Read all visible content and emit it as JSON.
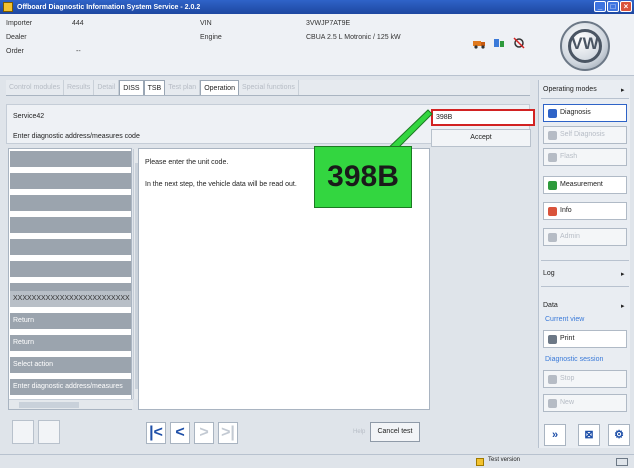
{
  "window": {
    "title": "Offboard Diagnostic Information System Service - 2.0.2"
  },
  "header": {
    "importer_label": "Importer",
    "importer_value": "444",
    "dealer_label": "Dealer",
    "order_label": "Order",
    "order_value": "--",
    "vin_label": "VIN",
    "vin_value": "3VWJP7AT9E",
    "engine_label": "Engine",
    "engine_value": "CBUA 2.5 L Motronic / 125 kW",
    "logo_text": "VW"
  },
  "tabs": [
    {
      "label": "Control modules"
    },
    {
      "label": "Results"
    },
    {
      "label": "Detail"
    },
    {
      "label": "DISS"
    },
    {
      "label": "TSB"
    },
    {
      "label": "Test plan"
    },
    {
      "label": "Operation"
    },
    {
      "label": "Special functions"
    }
  ],
  "service": {
    "title": "Service42",
    "prompt": "Enter diagnostic address/measures code",
    "code_value": "398B",
    "accept_label": "Accept"
  },
  "left_list": {
    "items": [
      {
        "label": ""
      },
      {
        "label": ""
      },
      {
        "label": ""
      },
      {
        "label": ""
      },
      {
        "label": ""
      },
      {
        "label": ""
      },
      {
        "label": ""
      },
      {
        "label": "XXXXXXXXXXXXXXXXXXXXXXXXX"
      },
      {
        "label": "Return"
      },
      {
        "label": "Return"
      },
      {
        "label": "Select action"
      },
      {
        "label": "Enter diagnostic address/measures"
      }
    ]
  },
  "content": {
    "line1": "Please enter the unit code.",
    "line2": "In the next step, the vehicle data will be read out."
  },
  "callout": {
    "text": "398B"
  },
  "footer": {
    "help_label": "Help",
    "cancel_label": "Cancel test"
  },
  "right_panel": {
    "operating_modes_label": "Operating modes",
    "buttons": [
      {
        "label": "Diagnosis",
        "enabled": true,
        "color": "#2e63c7"
      },
      {
        "label": "Self Diagnosis",
        "enabled": false,
        "color": "#b6bcc5"
      },
      {
        "label": "Flash",
        "enabled": false,
        "color": "#b6bcc5"
      },
      {
        "label": "Measurement",
        "enabled": true,
        "color": "#2e9a3c"
      },
      {
        "label": "Info",
        "enabled": true,
        "color": "#d9533b"
      },
      {
        "label": "Admin",
        "enabled": false,
        "color": "#b6bcc5"
      }
    ],
    "log_label": "Log",
    "data_label": "Data",
    "current_view_label": "Current view",
    "print_label": "Print",
    "diagnostic_session_label": "Diagnostic session",
    "stop_label": "Stop",
    "new_label": "New"
  },
  "status": {
    "text": "Test version"
  }
}
